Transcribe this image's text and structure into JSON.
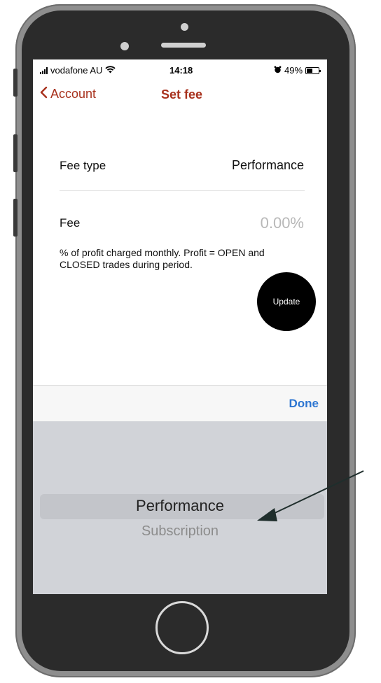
{
  "status_bar": {
    "carrier": "vodafone AU",
    "time": "14:18",
    "battery_percent": "49%",
    "battery_level": 0.49,
    "icons": [
      "signal-bars-icon",
      "wifi-icon",
      "alarm-icon",
      "battery-icon"
    ]
  },
  "nav": {
    "back_label": "Account",
    "title": "Set fee",
    "accent_color": "#a8311d"
  },
  "fee_type": {
    "label": "Fee type",
    "value": "Performance"
  },
  "fee": {
    "label": "Fee",
    "value": "0.00%",
    "help": "% of profit charged monthly. Profit = OPEN and CLOSED trades during period."
  },
  "update_button": {
    "label": "Update"
  },
  "toolbar": {
    "done_label": "Done",
    "done_color": "#2c75d1"
  },
  "picker": {
    "selected": "Performance",
    "options": [
      "Performance",
      "Subscription"
    ]
  }
}
